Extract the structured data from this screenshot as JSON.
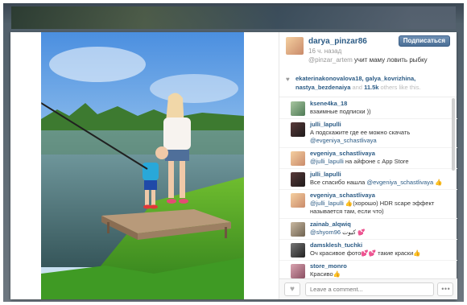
{
  "post": {
    "username": "darya_pinzar86",
    "time_ago": "16 ч. назад",
    "follow_label": "Подписаться",
    "caption_mentions": "@pinzar_artem",
    "caption_text": "учит маму ловить рыбку"
  },
  "likes": {
    "names": "ekaterinakonovalova18, galya_kovrizhina, nastya_bezdenaiya",
    "and": "and",
    "count": "11.5k",
    "rest": "others like this."
  },
  "comments": [
    {
      "user": "ksene4ka_18",
      "text": "взаимные подписки ))",
      "mention": ""
    },
    {
      "user": "julli_lapulli",
      "text": "А подскажите где ее можно скачать",
      "mention": "@evgeniya_schastlivaya"
    },
    {
      "user": "evgeniya_schastlivaya",
      "mention": "@julli_lapulli",
      "text": "на айфоне с App Store"
    },
    {
      "user": "julli_lapulli",
      "text": "Все спасибо нашла",
      "mention": "@evgeniya_schastlivaya 👍"
    },
    {
      "user": "evgeniya_schastlivaya",
      "mention": "@julli_lapulli",
      "text": "👍(хорошо) HDR scape эффект называется там, если что)"
    },
    {
      "user": "zainab_alqwiq",
      "mention": "@shyom96",
      "text": "كيوت 💕"
    },
    {
      "user": "damsklesh_tuchki",
      "text": "Оч красивое фото💕💕 такие краски👍",
      "mention": ""
    },
    {
      "user": "store_monro",
      "text": "Красиво👍",
      "mention": ""
    }
  ],
  "footer": {
    "comment_placeholder": "Leave a comment...",
    "more_label": "• • •"
  },
  "icons": {
    "heart": "heart-icon",
    "close": "close-icon",
    "more": "more-icon"
  },
  "colors": {
    "link": "#2b5b85",
    "follow_button": "#4b6f96"
  }
}
